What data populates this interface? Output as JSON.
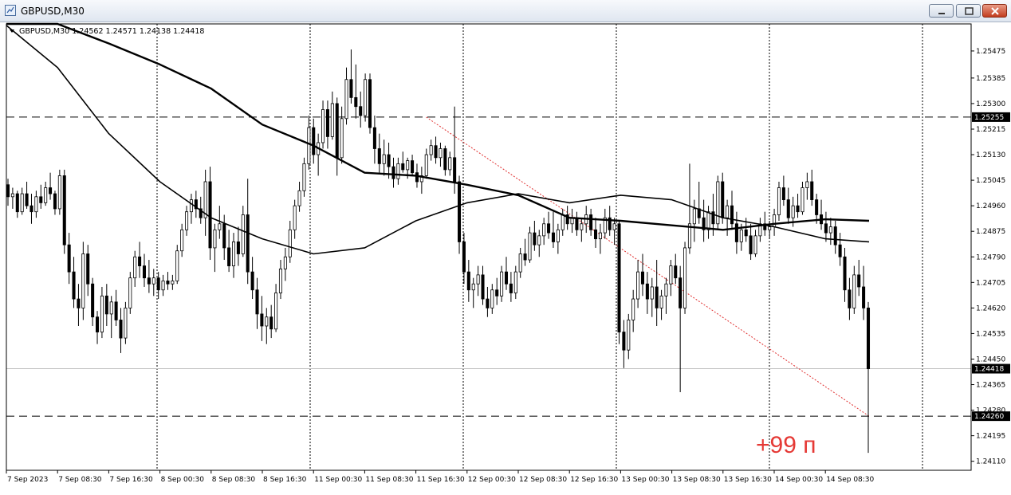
{
  "window": {
    "title": "GBPUSD,M30",
    "min_icon": "minimize-icon",
    "max_icon": "maximize-icon",
    "close_icon": "close-icon"
  },
  "chart_data": {
    "type": "candlestick",
    "symbol_header": "GBPUSD,M30  1.24562 1.24571 1.24138 1.24418",
    "symbol_header_icon": "triangle-down-icon",
    "y_ticks": [
      "1.25475",
      "1.25385",
      "1.25300",
      "1.25215",
      "1.25130",
      "1.25045",
      "1.24960",
      "1.24875",
      "1.24790",
      "1.24705",
      "1.24620",
      "1.24535",
      "1.24450",
      "1.24365",
      "1.24280",
      "1.24195",
      "1.24110"
    ],
    "ylim": [
      1.2408,
      1.25565
    ],
    "x_ticks": [
      "7 Sep 2023",
      "7 Sep 08:30",
      "7 Sep 16:30",
      "8 Sep 00:30",
      "8 Sep 08:30",
      "8 Sep 16:30",
      "11 Sep 00:30",
      "11 Sep 08:30",
      "11 Sep 16:30",
      "12 Sep 00:30",
      "12 Sep 08:30",
      "12 Sep 16:30",
      "13 Sep 00:30",
      "13 Sep 08:30",
      "13 Sep 16:30",
      "14 Sep 00:30",
      "14 Sep 08:30"
    ],
    "grid": true,
    "horizontal_lines": [
      {
        "price": 1.25255,
        "label": "1.25255",
        "style": "dashed"
      },
      {
        "price": 1.2426,
        "label": "1.24260",
        "style": "dashed"
      }
    ],
    "current_price": {
      "price": 1.24418,
      "label": "1.24418"
    },
    "trendline": {
      "from": {
        "x": "11 Sep 16:30",
        "y": 1.25255
      },
      "to": {
        "x": "14 Sep 12:30",
        "y": 1.2426
      },
      "color": "#e03030"
    },
    "annotation": {
      "text": "+99 п",
      "color": "#e53935"
    },
    "candles": [
      [
        1.2503,
        1.2505,
        1.2496,
        1.2499
      ],
      [
        1.2499,
        1.2502,
        1.2495,
        1.25
      ],
      [
        1.25,
        1.2501,
        1.2492,
        1.2494
      ],
      [
        1.2494,
        1.2502,
        1.2493,
        1.25
      ],
      [
        1.25,
        1.2504,
        1.2495,
        1.2496
      ],
      [
        1.2496,
        1.25,
        1.249,
        1.2494
      ],
      [
        1.2494,
        1.2501,
        1.2492,
        1.2499
      ],
      [
        1.2499,
        1.2503,
        1.2495,
        1.2497
      ],
      [
        1.2497,
        1.2504,
        1.2496,
        1.2502
      ],
      [
        1.2502,
        1.2507,
        1.2498,
        1.25
      ],
      [
        1.25,
        1.2501,
        1.2493,
        1.2495
      ],
      [
        1.2495,
        1.2508,
        1.2493,
        1.2506
      ],
      [
        1.2506,
        1.2508,
        1.248,
        1.2483
      ],
      [
        1.2483,
        1.2487,
        1.247,
        1.2474
      ],
      [
        1.2474,
        1.2479,
        1.2462,
        1.2465
      ],
      [
        1.2465,
        1.247,
        1.2456,
        1.2462
      ],
      [
        1.2462,
        1.2484,
        1.2458,
        1.248
      ],
      [
        1.248,
        1.2483,
        1.2466,
        1.247
      ],
      [
        1.247,
        1.2472,
        1.2456,
        1.2459
      ],
      [
        1.2459,
        1.2461,
        1.245,
        1.2454
      ],
      [
        1.2454,
        1.2469,
        1.2452,
        1.2466
      ],
      [
        1.2466,
        1.247,
        1.2456,
        1.246
      ],
      [
        1.246,
        1.2466,
        1.2452,
        1.2464
      ],
      [
        1.2464,
        1.2468,
        1.2456,
        1.2458
      ],
      [
        1.2458,
        1.2462,
        1.2447,
        1.2452
      ],
      [
        1.2452,
        1.2464,
        1.245,
        1.2462
      ],
      [
        1.2462,
        1.2474,
        1.246,
        1.2472
      ],
      [
        1.2472,
        1.2481,
        1.2469,
        1.2479
      ],
      [
        1.2479,
        1.2484,
        1.2472,
        1.2476
      ],
      [
        1.2476,
        1.248,
        1.2469,
        1.2472
      ],
      [
        1.2472,
        1.2478,
        1.2467,
        1.247
      ],
      [
        1.247,
        1.2475,
        1.2466,
        1.2472
      ],
      [
        1.2472,
        1.2474,
        1.2465,
        1.2468
      ],
      [
        1.2468,
        1.2473,
        1.2466,
        1.2471
      ],
      [
        1.2471,
        1.2474,
        1.2468,
        1.247
      ],
      [
        1.247,
        1.2473,
        1.2468,
        1.2471
      ],
      [
        1.2471,
        1.2483,
        1.247,
        1.2481
      ],
      [
        1.2481,
        1.249,
        1.2479,
        1.2488
      ],
      [
        1.2488,
        1.2496,
        1.2486,
        1.2494
      ],
      [
        1.2494,
        1.25,
        1.249,
        1.2498
      ],
      [
        1.2498,
        1.2501,
        1.2492,
        1.2495
      ],
      [
        1.2495,
        1.2499,
        1.249,
        1.2492
      ],
      [
        1.2492,
        1.2508,
        1.2486,
        1.2504
      ],
      [
        1.2504,
        1.2509,
        1.2478,
        1.2482
      ],
      [
        1.2482,
        1.249,
        1.2474,
        1.2488
      ],
      [
        1.2488,
        1.2496,
        1.2485,
        1.249
      ],
      [
        1.249,
        1.2493,
        1.2478,
        1.2482
      ],
      [
        1.2482,
        1.2488,
        1.2474,
        1.2476
      ],
      [
        1.2476,
        1.2487,
        1.2472,
        1.2484
      ],
      [
        1.2484,
        1.2489,
        1.2476,
        1.248
      ],
      [
        1.248,
        1.2496,
        1.2479,
        1.2493
      ],
      [
        1.2493,
        1.2505,
        1.247,
        1.2474
      ],
      [
        1.2474,
        1.2479,
        1.2465,
        1.2468
      ],
      [
        1.2468,
        1.2472,
        1.2455,
        1.246
      ],
      [
        1.246,
        1.2466,
        1.2451,
        1.2456
      ],
      [
        1.2456,
        1.2462,
        1.245,
        1.2459
      ],
      [
        1.2459,
        1.2463,
        1.2452,
        1.2455
      ],
      [
        1.2455,
        1.247,
        1.2454,
        1.2467
      ],
      [
        1.2467,
        1.2478,
        1.2465,
        1.2475
      ],
      [
        1.2475,
        1.2482,
        1.2471,
        1.2479
      ],
      [
        1.2479,
        1.2491,
        1.2477,
        1.2488
      ],
      [
        1.2488,
        1.2498,
        1.2485,
        1.2496
      ],
      [
        1.2496,
        1.2504,
        1.2494,
        1.2501
      ],
      [
        1.2501,
        1.2512,
        1.2499,
        1.251
      ],
      [
        1.251,
        1.2526,
        1.2508,
        1.2522
      ],
      [
        1.2522,
        1.2525,
        1.251,
        1.2513
      ],
      [
        1.2513,
        1.252,
        1.2506,
        1.2517
      ],
      [
        1.2517,
        1.2531,
        1.2515,
        1.2528
      ],
      [
        1.2528,
        1.2531,
        1.2515,
        1.2519
      ],
      [
        1.2519,
        1.2534,
        1.2518,
        1.253
      ],
      [
        1.253,
        1.2532,
        1.2506,
        1.2512
      ],
      [
        1.2512,
        1.2529,
        1.251,
        1.2525
      ],
      [
        1.2525,
        1.2542,
        1.2523,
        1.2538
      ],
      [
        1.2538,
        1.2548,
        1.253,
        1.2532
      ],
      [
        1.2532,
        1.2543,
        1.2525,
        1.2529
      ],
      [
        1.2529,
        1.2534,
        1.2522,
        1.2526
      ],
      [
        1.2526,
        1.254,
        1.2524,
        1.2538
      ],
      [
        1.2538,
        1.254,
        1.252,
        1.2522
      ],
      [
        1.2522,
        1.2526,
        1.251,
        1.2515
      ],
      [
        1.2515,
        1.252,
        1.2507,
        1.251
      ],
      [
        1.251,
        1.2518,
        1.2506,
        1.2513
      ],
      [
        1.2513,
        1.2517,
        1.2505,
        1.2509
      ],
      [
        1.2509,
        1.2512,
        1.2502,
        1.2505
      ],
      [
        1.2505,
        1.2512,
        1.2503,
        1.251
      ],
      [
        1.251,
        1.2514,
        1.2507,
        1.2508
      ],
      [
        1.2508,
        1.2512,
        1.2505,
        1.2511
      ],
      [
        1.2511,
        1.2513,
        1.2506,
        1.2507
      ],
      [
        1.2507,
        1.251,
        1.2502,
        1.2504
      ],
      [
        1.2504,
        1.2509,
        1.25,
        1.2506
      ],
      [
        1.2506,
        1.2515,
        1.2505,
        1.2513
      ],
      [
        1.2513,
        1.2518,
        1.2511,
        1.2516
      ],
      [
        1.2516,
        1.2519,
        1.251,
        1.2512
      ],
      [
        1.2512,
        1.2517,
        1.2509,
        1.2515
      ],
      [
        1.2515,
        1.2516,
        1.2506,
        1.2508
      ],
      [
        1.2508,
        1.2514,
        1.2506,
        1.2512
      ],
      [
        1.2512,
        1.2529,
        1.25,
        1.2504
      ],
      [
        1.2504,
        1.2506,
        1.248,
        1.2484
      ],
      [
        1.2484,
        1.2487,
        1.247,
        1.2474
      ],
      [
        1.2474,
        1.2478,
        1.2464,
        1.2468
      ],
      [
        1.2468,
        1.2472,
        1.2462,
        1.247
      ],
      [
        1.247,
        1.2476,
        1.2466,
        1.2473
      ],
      [
        1.2473,
        1.2476,
        1.2463,
        1.2465
      ],
      [
        1.2465,
        1.2469,
        1.2459,
        1.2462
      ],
      [
        1.2462,
        1.247,
        1.246,
        1.2468
      ],
      [
        1.2468,
        1.2472,
        1.2463,
        1.2466
      ],
      [
        1.2466,
        1.2476,
        1.2464,
        1.2474
      ],
      [
        1.2474,
        1.2479,
        1.2468,
        1.247
      ],
      [
        1.247,
        1.2474,
        1.2464,
        1.2467
      ],
      [
        1.2467,
        1.2476,
        1.2465,
        1.2474
      ],
      [
        1.2474,
        1.2482,
        1.2472,
        1.248
      ],
      [
        1.248,
        1.2485,
        1.2476,
        1.2478
      ],
      [
        1.2478,
        1.2489,
        1.2477,
        1.2487
      ],
      [
        1.2487,
        1.2491,
        1.2481,
        1.2483
      ],
      [
        1.2483,
        1.2488,
        1.2479,
        1.2486
      ],
      [
        1.2486,
        1.2492,
        1.2483,
        1.249
      ],
      [
        1.249,
        1.2494,
        1.2485,
        1.2487
      ],
      [
        1.2487,
        1.2494,
        1.2482,
        1.2484
      ],
      [
        1.2484,
        1.249,
        1.248,
        1.2488
      ],
      [
        1.2488,
        1.2495,
        1.2486,
        1.2493
      ],
      [
        1.2493,
        1.2496,
        1.2488,
        1.249
      ],
      [
        1.249,
        1.2495,
        1.2487,
        1.2492
      ],
      [
        1.2492,
        1.2494,
        1.2486,
        1.2488
      ],
      [
        1.2488,
        1.2492,
        1.2484,
        1.249
      ],
      [
        1.249,
        1.2496,
        1.2487,
        1.2493
      ],
      [
        1.2493,
        1.2495,
        1.2486,
        1.2488
      ],
      [
        1.2488,
        1.2492,
        1.2482,
        1.2485
      ],
      [
        1.2485,
        1.249,
        1.248,
        1.2487
      ],
      [
        1.2487,
        1.2495,
        1.2485,
        1.2492
      ],
      [
        1.2492,
        1.2496,
        1.2486,
        1.2488
      ],
      [
        1.2488,
        1.2492,
        1.2483,
        1.249
      ],
      [
        1.249,
        1.2491,
        1.245,
        1.2454
      ],
      [
        1.2454,
        1.2458,
        1.2442,
        1.2448
      ],
      [
        1.2448,
        1.246,
        1.2445,
        1.2458
      ],
      [
        1.2458,
        1.2468,
        1.2454,
        1.2465
      ],
      [
        1.2465,
        1.2478,
        1.2462,
        1.2474
      ],
      [
        1.2474,
        1.248,
        1.2466,
        1.247
      ],
      [
        1.247,
        1.2474,
        1.246,
        1.2465
      ],
      [
        1.2465,
        1.2472,
        1.2459,
        1.2469
      ],
      [
        1.2469,
        1.2478,
        1.2456,
        1.2462
      ],
      [
        1.2462,
        1.2468,
        1.2458,
        1.2466
      ],
      [
        1.2466,
        1.2472,
        1.246,
        1.247
      ],
      [
        1.247,
        1.2478,
        1.2466,
        1.2476
      ],
      [
        1.2476,
        1.248,
        1.247,
        1.2472
      ],
      [
        1.2472,
        1.2476,
        1.2434,
        1.2462
      ],
      [
        1.2462,
        1.2484,
        1.246,
        1.2482
      ],
      [
        1.2482,
        1.251,
        1.248,
        1.249
      ],
      [
        1.249,
        1.2498,
        1.2484,
        1.2495
      ],
      [
        1.2495,
        1.2504,
        1.249,
        1.2492
      ],
      [
        1.2492,
        1.2498,
        1.2484,
        1.2488
      ],
      [
        1.2488,
        1.2496,
        1.2485,
        1.2494
      ],
      [
        1.2494,
        1.25,
        1.2486,
        1.249
      ],
      [
        1.249,
        1.2506,
        1.2488,
        1.2504
      ],
      [
        1.2504,
        1.2507,
        1.249,
        1.2492
      ],
      [
        1.2492,
        1.2498,
        1.2486,
        1.2496
      ],
      [
        1.2496,
        1.2501,
        1.2488,
        1.249
      ],
      [
        1.249,
        1.2494,
        1.248,
        1.2484
      ],
      [
        1.2484,
        1.249,
        1.2481,
        1.2488
      ],
      [
        1.2488,
        1.2492,
        1.2484,
        1.2486
      ],
      [
        1.2486,
        1.249,
        1.2478,
        1.248
      ],
      [
        1.248,
        1.2488,
        1.2479,
        1.2486
      ],
      [
        1.2486,
        1.2492,
        1.2484,
        1.249
      ],
      [
        1.249,
        1.2494,
        1.2486,
        1.2488
      ],
      [
        1.2488,
        1.2491,
        1.2485,
        1.2489
      ],
      [
        1.2489,
        1.2495,
        1.2486,
        1.2493
      ],
      [
        1.2493,
        1.2504,
        1.2491,
        1.2502
      ],
      [
        1.2502,
        1.2506,
        1.2496,
        1.2498
      ],
      [
        1.2498,
        1.2502,
        1.249,
        1.2492
      ],
      [
        1.2492,
        1.2499,
        1.2489,
        1.2496
      ],
      [
        1.2496,
        1.25,
        1.2492,
        1.2494
      ],
      [
        1.2494,
        1.2504,
        1.2493,
        1.2502
      ],
      [
        1.2502,
        1.2507,
        1.2498,
        1.2504
      ],
      [
        1.2504,
        1.2508,
        1.2496,
        1.2498
      ],
      [
        1.2498,
        1.25,
        1.249,
        1.2493
      ],
      [
        1.2493,
        1.2498,
        1.2488,
        1.249
      ],
      [
        1.249,
        1.2494,
        1.2484,
        1.2487
      ],
      [
        1.2487,
        1.2492,
        1.2483,
        1.2489
      ],
      [
        1.2489,
        1.2491,
        1.248,
        1.2483
      ],
      [
        1.2483,
        1.2487,
        1.2476,
        1.2479
      ],
      [
        1.2479,
        1.2482,
        1.2464,
        1.2468
      ],
      [
        1.2468,
        1.2472,
        1.2458,
        1.2462
      ],
      [
        1.2462,
        1.2476,
        1.246,
        1.2473
      ],
      [
        1.2473,
        1.2478,
        1.2466,
        1.2469
      ],
      [
        1.2469,
        1.2476,
        1.2458,
        1.2462
      ],
      [
        1.2462,
        1.2464,
        1.24138,
        1.24418
      ]
    ],
    "ma_slow_points": [
      [
        "7 Sep 2023",
        1.2562
      ],
      [
        "7 Sep 08:30",
        1.2557
      ],
      [
        "7 Sep 16:30",
        1.255
      ],
      [
        "8 Sep 00:30",
        1.2543
      ],
      [
        "8 Sep 08:30",
        1.2535
      ],
      [
        "8 Sep 16:30",
        1.2523
      ],
      [
        "11 Sep 00:30",
        1.2516
      ],
      [
        "11 Sep 08:30",
        1.2507
      ],
      [
        "11 Sep 16:30",
        1.2506
      ],
      [
        "12 Sep 00:30",
        1.2503
      ],
      [
        "12 Sep 08:30",
        1.24995
      ],
      [
        "12 Sep 16:30",
        1.2492
      ],
      [
        "13 Sep 00:30",
        1.2491
      ],
      [
        "13 Sep 08:30",
        1.24895
      ],
      [
        "13 Sep 16:30",
        1.2488
      ],
      [
        "14 Sep 00:30",
        1.249
      ],
      [
        "14 Sep 08:30",
        1.24915
      ],
      [
        "14 Sep 12:30",
        1.2491
      ]
    ],
    "ma_mid_points": [
      [
        "7 Sep 2023",
        1.2556
      ],
      [
        "7 Sep 08:30",
        1.2542
      ],
      [
        "7 Sep 16:30",
        1.252
      ],
      [
        "8 Sep 00:30",
        1.2504
      ],
      [
        "8 Sep 08:30",
        1.2492
      ],
      [
        "8 Sep 16:30",
        1.2485
      ],
      [
        "11 Sep 00:30",
        1.248
      ],
      [
        "11 Sep 08:30",
        1.2482
      ],
      [
        "11 Sep 16:30",
        1.2491
      ],
      [
        "12 Sep 00:30",
        1.2497
      ],
      [
        "12 Sep 08:30",
        1.25
      ],
      [
        "12 Sep 16:30",
        1.2497
      ],
      [
        "13 Sep 00:30",
        1.24995
      ],
      [
        "13 Sep 08:30",
        1.2498
      ],
      [
        "13 Sep 16:30",
        1.2492
      ],
      [
        "14 Sep 00:30",
        1.2489
      ],
      [
        "14 Sep 08:30",
        1.2485
      ],
      [
        "14 Sep 12:30",
        1.2484
      ]
    ]
  }
}
